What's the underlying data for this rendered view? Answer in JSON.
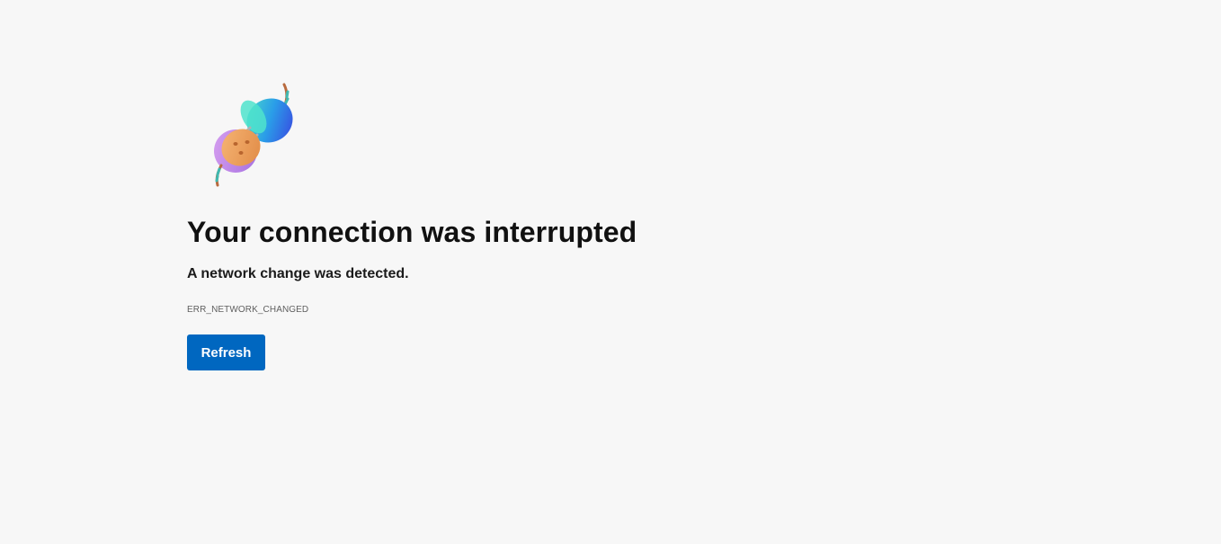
{
  "illustration": {
    "icon": "unplugged-plug-icon",
    "colors": {
      "plug_orange": "#f0a35e",
      "plug_purple": "#c58ae8",
      "socket_teal": "#3fd6c0",
      "socket_blue": "#2f6be6",
      "cable_brown": "#b86a3e"
    }
  },
  "error": {
    "title": "Your connection was interrupted",
    "message": "A network change was detected.",
    "code": "ERR_NETWORK_CHANGED"
  },
  "actions": {
    "refresh_label": "Refresh"
  },
  "colors": {
    "background": "#f7f7f7",
    "button": "#0067c0",
    "button_text": "#ffffff"
  }
}
